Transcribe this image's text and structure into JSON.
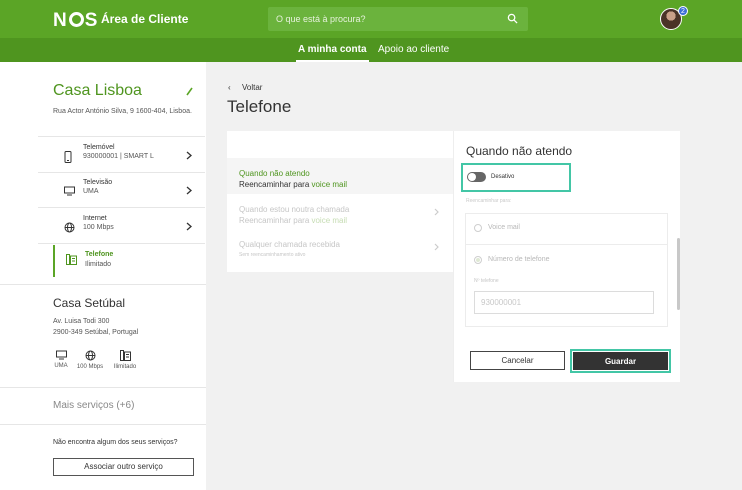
{
  "header": {
    "brand": "N",
    "brand_end": "S",
    "title": "Área de Cliente",
    "search_placeholder": "O que está à procura?",
    "notification_count": "2"
  },
  "subnav": {
    "tabs": [
      {
        "label": "A minha conta"
      },
      {
        "label": "Apoio ao cliente"
      }
    ]
  },
  "sidebar": {
    "home1": {
      "title": "Casa Lisboa",
      "address": "Rua Actor António Silva, 9 1600-404, Lisboa."
    },
    "services": [
      {
        "name": "Telemóvel",
        "sub": "930000001 | SMART L",
        "icon": "phone-icon"
      },
      {
        "name": "Televisão",
        "sub": "UMA",
        "icon": "tv-icon"
      },
      {
        "name": "Internet",
        "sub": "100 Mbps",
        "icon": "globe-icon"
      },
      {
        "name": "Telefone",
        "sub": "Ilimitado",
        "icon": "landline-icon"
      }
    ],
    "home2": {
      "title": "Casa Setúbal",
      "address_line1": "Av. Luisa Todi 300",
      "address_line2": "2900-349 Setúbal, Portugal",
      "mini": [
        {
          "label": "UMA",
          "icon": "tv-icon"
        },
        {
          "label": "100 Mbps",
          "icon": "globe-icon"
        },
        {
          "label": "Ilimitado",
          "icon": "landline-icon"
        }
      ]
    },
    "more_services": "Mais serviços (+6)",
    "missing_text": "Não encontra algum dos seus serviços?",
    "associate_button": "Associar outro serviço"
  },
  "main": {
    "back": "Voltar",
    "title": "Telefone",
    "options": [
      {
        "title": "Quando não atendo",
        "sub_prefix": "Reencaminhar para ",
        "sub_link": "voice mail"
      },
      {
        "title": "Quando estou noutra chamada",
        "sub_prefix": "Reencaminhar para ",
        "sub_link": "voice mail"
      },
      {
        "title": "Qualquer chamada recebida",
        "sub_prefix": "Sem reencaminhamento ativo",
        "sub_link": ""
      }
    ],
    "detail": {
      "title": "Quando não atendo",
      "toggle_label": "Desativo",
      "forward_label": "Reencaminhar para:",
      "choice_voicemail": "Voice mail",
      "choice_number": "Número de telefone",
      "number_label": "Nº telefone",
      "number_value": "930000001",
      "cancel": "Cancelar",
      "save": "Guardar"
    }
  },
  "colors": {
    "brand_green": "#5ba526",
    "dark_green": "#4f951f",
    "highlight": "#43c6a6"
  }
}
